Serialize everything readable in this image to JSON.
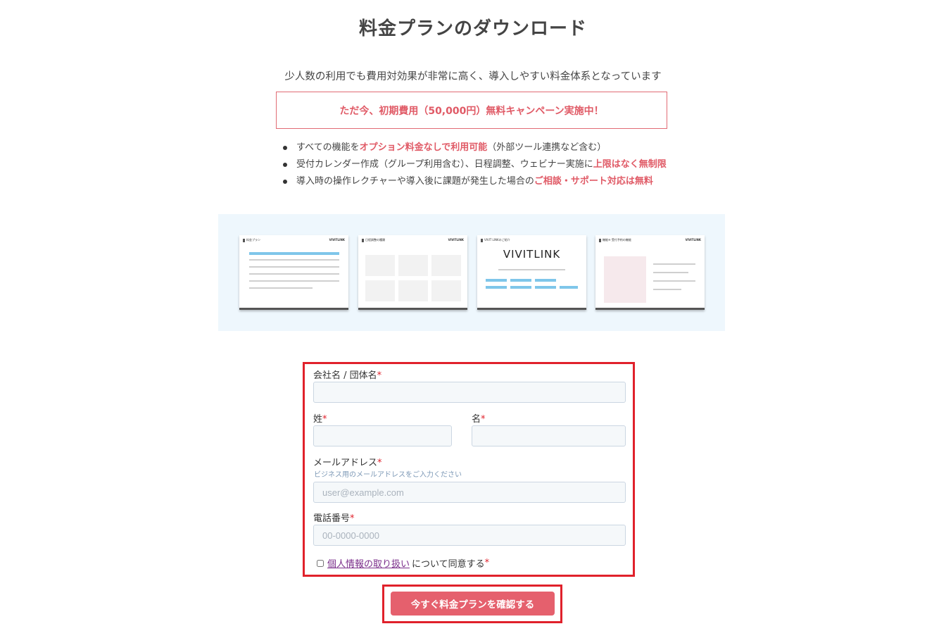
{
  "header": {
    "title": "料金プランのダウンロード",
    "subtitle": "少人数の利用でも費用対効果が非常に高く、導入しやすい料金体系となっています",
    "campaign": "ただ今、初期費用（50,000円）無料キャンペーン実施中！"
  },
  "features": [
    {
      "pre": "すべての機能を",
      "hl": "オプション料金なしで利用可能",
      "post": "（外部ツール連携など含む）"
    },
    {
      "pre": "受付カレンダー作成（グループ利用含む）、日程調整、ウェビナー実施に",
      "hl": "上限はなく無制限",
      "post": ""
    },
    {
      "pre": "導入時の操作レクチャーや導入後に課題が発生した場合の",
      "hl": "ご相談・サポート対応は無料",
      "post": ""
    }
  ],
  "previews": {
    "t1": {
      "heading": "料金プラン",
      "logo": "VIVITLINK"
    },
    "t2": {
      "heading": "日程調整の種類",
      "logo": "VIVITLINK"
    },
    "t3": {
      "heading": "VIVIT LINKのご紹介",
      "big_logo": "VIVITLINK"
    },
    "t4": {
      "heading": "機能④ 受付予約の機能",
      "logo": "VIVITLINK"
    }
  },
  "form": {
    "company_label": "会社名 / 団体名",
    "last_name_label": "姓",
    "first_name_label": "名",
    "email_label": "メールアドレス",
    "email_hint": "ビジネス用のメールアドレスをご入力ください",
    "email_placeholder": "user@example.com",
    "phone_label": "電話番号",
    "phone_placeholder": "00-0000-0000",
    "required_mark": "*",
    "consent_link": "個人情報の取り扱い",
    "consent_text": "について同意する"
  },
  "submit": {
    "label": "今すぐ料金プランを確認する"
  },
  "colors": {
    "accent": "#e05a66",
    "highlight_frame": "#e0212b",
    "preview_bg": "#eef7fd"
  }
}
